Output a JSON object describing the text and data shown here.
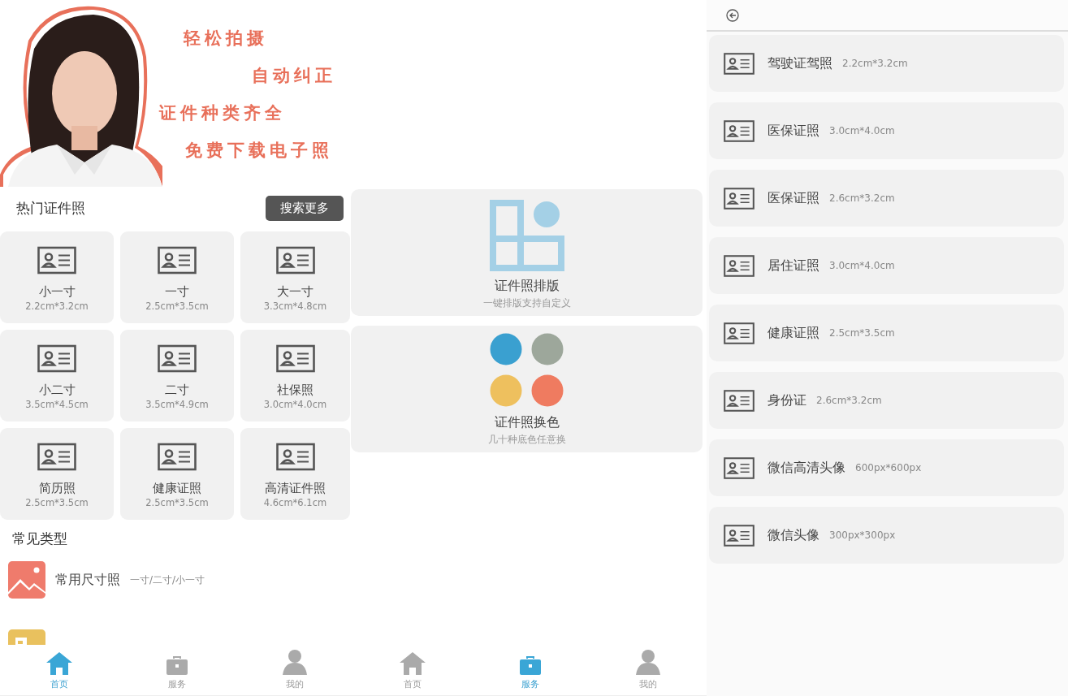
{
  "home": {
    "banner": {
      "slogans": [
        "轻松拍摄",
        "自动纠正",
        "证件种类齐全",
        "免费下载电子照"
      ]
    },
    "hot_section": {
      "title": "热门证件照",
      "search_button": "搜索更多"
    },
    "hot_items": [
      {
        "name": "小一寸",
        "size": "2.2cm*3.2cm"
      },
      {
        "name": "一寸",
        "size": "2.5cm*3.5cm"
      },
      {
        "name": "大一寸",
        "size": "3.3cm*4.8cm"
      },
      {
        "name": "小二寸",
        "size": "3.5cm*4.5cm"
      },
      {
        "name": "二寸",
        "size": "3.5cm*4.9cm"
      },
      {
        "name": "社保照",
        "size": "3.0cm*4.0cm"
      },
      {
        "name": "简历照",
        "size": "2.5cm*3.5cm"
      },
      {
        "name": "健康证照",
        "size": "2.5cm*3.5cm"
      },
      {
        "name": "高清证件照",
        "size": "4.6cm*6.1cm"
      }
    ],
    "common_section": {
      "title": "常见类型",
      "items": [
        {
          "title": "常用尺寸照",
          "subtitle": "一寸/二寸/小一寸"
        },
        {
          "kind": "document"
        }
      ]
    },
    "tab_bar": {
      "tabs": [
        {
          "kind": "home",
          "label": "首页",
          "selected": true
        },
        {
          "kind": "service",
          "label": "服务",
          "selected": false
        },
        {
          "kind": "profile",
          "label": "我的",
          "selected": false
        }
      ]
    }
  },
  "services": {
    "cards": [
      {
        "kind": "layout",
        "title": "证件照排版",
        "subtitle": "一键排版支持自定义"
      },
      {
        "kind": "recolor",
        "title": "证件照换色",
        "subtitle": "几十种底色任意换"
      }
    ],
    "tab_bar": {
      "tabs": [
        {
          "kind": "home",
          "label": "首页",
          "selected": false
        },
        {
          "kind": "service",
          "label": "服务",
          "selected": true
        },
        {
          "kind": "profile",
          "label": "我的",
          "selected": false
        }
      ]
    }
  },
  "size_list": {
    "items": [
      {
        "name": "驾驶证驾照",
        "size": "2.2cm*3.2cm"
      },
      {
        "name": "医保证照",
        "size": "3.0cm*4.0cm"
      },
      {
        "name": "医保证照",
        "size": "2.6cm*3.2cm"
      },
      {
        "name": "居住证照",
        "size": "3.0cm*4.0cm"
      },
      {
        "name": "健康证照",
        "size": "2.5cm*3.5cm"
      },
      {
        "name": "身份证",
        "size": "2.6cm*3.2cm"
      },
      {
        "name": "微信高清头像",
        "size": "600px*600px"
      },
      {
        "name": "微信头像",
        "size": "300px*300px"
      }
    ]
  }
}
